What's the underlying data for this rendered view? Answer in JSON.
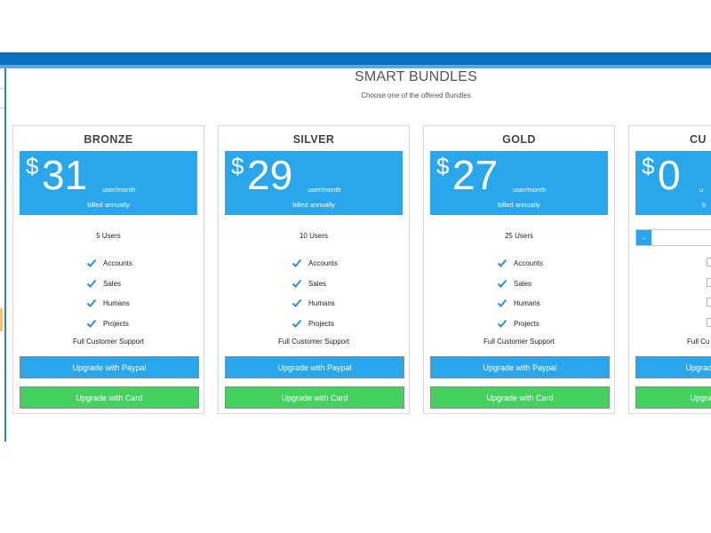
{
  "page": {
    "heading": "SMART BUNDLES",
    "subheading": "Choose one of the offered Bundles"
  },
  "plans": [
    {
      "title": "BRONZE",
      "currency": "$",
      "price": "31",
      "per": "user/month",
      "billing": "billed annually",
      "users": "5 Users",
      "features": [
        "Accounts",
        "Sales",
        "Humans",
        "Projects"
      ],
      "support": "Full Customer Support",
      "paypal_label": "Upgrade with Paypal",
      "card_label": "Upgrade with Card"
    },
    {
      "title": "SILVER",
      "currency": "$",
      "price": "29",
      "per": "user/month",
      "billing": "billed annually",
      "users": "10 Users",
      "features": [
        "Accounts",
        "Sales",
        "Humans",
        "Projects"
      ],
      "support": "Full Customer Support",
      "paypal_label": "Upgrade with Paypal",
      "card_label": "Upgrade with Card"
    },
    {
      "title": "GOLD",
      "currency": "$",
      "price": "27",
      "per": "user/month",
      "billing": "billed annually",
      "users": "25 Users",
      "features": [
        "Accounts",
        "Sales",
        "Humans",
        "Projects"
      ],
      "support": "Full Customer Support",
      "paypal_label": "Upgrade with Paypal",
      "card_label": "Upgrade with Card"
    },
    {
      "title": "CU",
      "currency": "$",
      "price": "0",
      "per": "u",
      "billing": "b",
      "stepper_minus": "-",
      "support": "Full Cu",
      "paypal_label": "Upgrad",
      "card_label": "Upgra"
    }
  ],
  "colors": {
    "topbar": "#0a6fbf",
    "accent_blue": "#2aa6ec",
    "card_button_green": "#45d160",
    "check_icon": "#2a8fdc"
  },
  "icons": {
    "feature": "check-icon"
  }
}
